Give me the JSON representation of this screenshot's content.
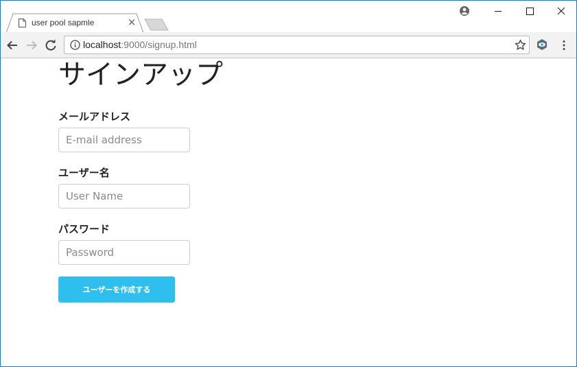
{
  "browser": {
    "tab": {
      "title": "user pool sapmle",
      "close_glyph": "×",
      "favicon": "page-icon"
    },
    "address_bar": {
      "host": "localhost",
      "path": ":9000/signup.html"
    },
    "icons": {
      "profile": "account-circle-icon",
      "back": "arrow-back-icon",
      "forward": "arrow-forward-icon",
      "reload": "reload-icon",
      "info": "info-icon",
      "bookmark": "star-icon",
      "extension": "eye-extension-icon",
      "menu": "kebab-menu-icon"
    }
  },
  "form": {
    "title": "サインアップ",
    "email": {
      "label": "メールアドレス",
      "placeholder": "E-mail address",
      "value": ""
    },
    "username": {
      "label": "ユーザー名",
      "placeholder": "User Name",
      "value": ""
    },
    "password": {
      "label": "パスワード",
      "placeholder": "Password",
      "value": ""
    },
    "submit_label": "ユーザーを作成する"
  },
  "colors": {
    "accent": "#2fbfee",
    "window_border": "#1979ca",
    "toolbar": "#f2f2f2"
  }
}
